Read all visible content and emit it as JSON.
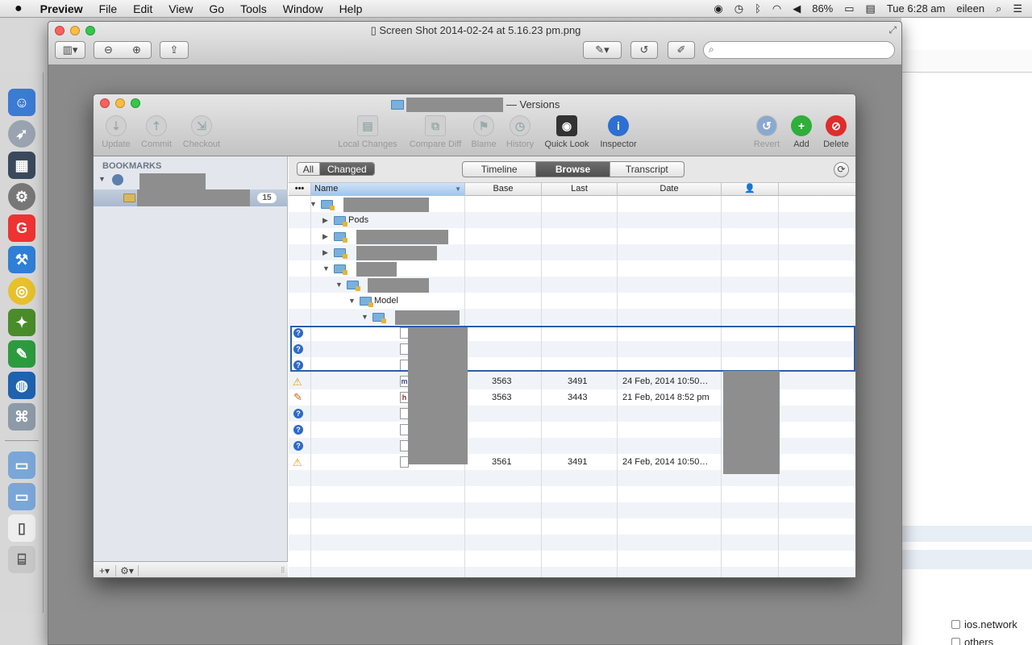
{
  "menubar": {
    "apple": "",
    "app": "Preview",
    "items": [
      "File",
      "Edit",
      "View",
      "Go",
      "Tools",
      "Window",
      "Help"
    ],
    "battery": "86%",
    "clock": "Tue 6:28 am",
    "user": "eileen"
  },
  "preview": {
    "title": "Screen Shot 2014-02-24 at 5.16.23 pm.png",
    "search_placeholder": ""
  },
  "versions": {
    "title_suffix": "— Versions",
    "toolbar_left": [
      "Update",
      "Commit",
      "Checkout"
    ],
    "toolbar_mid": [
      "Local Changes",
      "Compare Diff",
      "Blame",
      "History",
      "Quick Look",
      "Inspector"
    ],
    "toolbar_right": [
      "Revert",
      "Add",
      "Delete"
    ],
    "sidebar": {
      "heading": "BOOKMARKS",
      "badge": "15",
      "footer_add": "+",
      "footer_gear": "⚙"
    },
    "filter": {
      "all": "All",
      "changed": "Changed"
    },
    "views": {
      "timeline": "Timeline",
      "browse": "Browse",
      "transcript": "Transcript"
    },
    "columns": {
      "name": "Name",
      "base": "Base",
      "last": "Last",
      "date": "Date"
    },
    "rows": [
      {
        "name": "",
        "base": "",
        "last": "",
        "date": ""
      },
      {
        "name": "Pods",
        "base": "",
        "last": "",
        "date": ""
      },
      {
        "name": "",
        "base": "",
        "last": "",
        "date": ""
      },
      {
        "name": "",
        "base": "",
        "last": "",
        "date": ""
      },
      {
        "name": "",
        "base": "",
        "last": "",
        "date": ""
      },
      {
        "name": "",
        "base": "",
        "last": "",
        "date": ""
      },
      {
        "name": "Model",
        "base": "",
        "last": "",
        "date": ""
      },
      {
        "name": "",
        "base": "",
        "last": "",
        "date": ""
      },
      {
        "name": "",
        "base": "",
        "last": "",
        "date": ""
      },
      {
        "name": "",
        "base": "",
        "last": "",
        "date": ""
      },
      {
        "name": "",
        "base": "",
        "last": "",
        "date": ""
      },
      {
        "name": "",
        "base": "3563",
        "last": "3491",
        "date": "24 Feb, 2014 10:50…"
      },
      {
        "name": "",
        "base": "3563",
        "last": "3443",
        "date": "21 Feb, 2014 8:52 pm"
      },
      {
        "name": "",
        "base": "",
        "last": "",
        "date": ""
      },
      {
        "name": "",
        "base": "",
        "last": "",
        "date": ""
      },
      {
        "name": "",
        "base": "",
        "last": "",
        "date": ""
      },
      {
        "name": "",
        "base": "3561",
        "last": "3491",
        "date": "24 Feb, 2014 10:50…"
      }
    ],
    "file_glyph_m": "m",
    "file_glyph_h": "h"
  },
  "background": {
    "checkbox_1": "ios.network",
    "checkbox_2": "others"
  }
}
